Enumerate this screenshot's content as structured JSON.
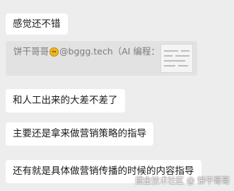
{
  "messages": [
    {
      "text": "感觉还不错"
    },
    {
      "text": "和人工出来的大差不差了"
    },
    {
      "text": "主要还是拿来做营销策略的指导"
    },
    {
      "text": "还有就是具体做营销传播的时候的内容指导"
    }
  ],
  "quote": {
    "prefix": "饼干哥哥",
    "suffix": "@bggg.tech（AI 编程：",
    "emoji_icon": "dizzy-face-emoji"
  },
  "watermark": "掘金技术社区 @ 饼干哥哥"
}
